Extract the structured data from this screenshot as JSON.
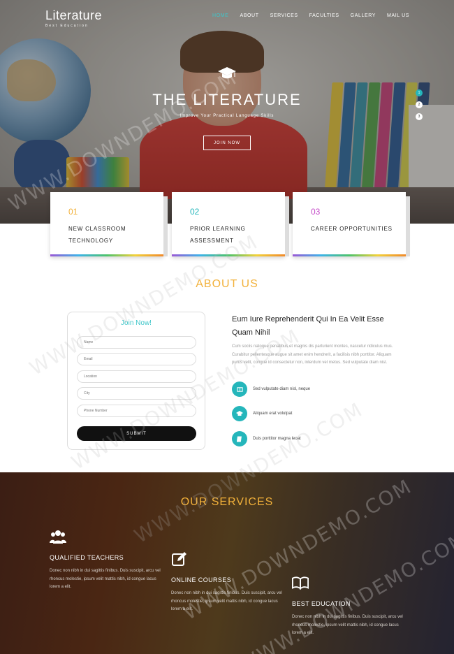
{
  "brand": {
    "title": "Literature",
    "subtitle": "Best Education"
  },
  "nav": {
    "items": [
      "HOME",
      "ABOUT",
      "SERVICES",
      "FACULTIES",
      "GALLERY",
      "MAIL US"
    ],
    "active": "HOME"
  },
  "hero": {
    "title": "THE LITERATURE",
    "subtitle": "Improve Your Practical Language Skills",
    "button": "JOIN NOW",
    "slides": [
      "1",
      "2",
      "3"
    ],
    "active_slide": "1"
  },
  "features": [
    {
      "num": "01",
      "title": "NEW CLASSROOM TECHNOLOGY",
      "color": "#f2b13a"
    },
    {
      "num": "02",
      "title": "PRIOR LEARNING ASSESSMENT",
      "color": "#25b6bb"
    },
    {
      "num": "03",
      "title": "CAREER OPPORTUNITIES",
      "color": "#c44bc8"
    }
  ],
  "about": {
    "title": "ABOUT US",
    "form": {
      "title": "Join Now!",
      "fields": [
        "Name",
        "Email",
        "Location",
        "City",
        "Phone Number"
      ],
      "submit": "SUBMIT"
    },
    "heading": "Eum Iure Reprehenderit Qui In Ea Velit Esse Quam Nihil",
    "body": "Cum sociis natoque penatibus et magnis dis parturient montes, nascetur ridiculus mus. Curabitur pellentesque augue sit amet enim hendrerit, a facilisis nibh porttitor. Aliquam purus velit, congue id consectetur non, interdum vel metus. Sed vulputate diam nisl.",
    "items": [
      {
        "icon": "book-icon",
        "label": "Sed vulputate diam nisl, neque"
      },
      {
        "icon": "graduation-cap-icon",
        "label": "Aliquam erat volutpat"
      },
      {
        "icon": "notebook-icon",
        "label": "Duis porttitor magna leoat"
      }
    ]
  },
  "services": {
    "title": "OUR SERVICES",
    "items": [
      {
        "icon": "users-icon",
        "title": "QUALIFIED TEACHERS",
        "desc": "Donec non nibh in dui sagittis finibus. Duis suscipit, arcu vel rhoncus molestie, ipsum velit mattis nibh, id congue lacus lorem a elit."
      },
      {
        "icon": "edit-icon",
        "title": "ONLINE COURSES",
        "desc": "Donec non nibh in dui sagittis finibus. Duis suscipit, arcu vel rhoncus molestie, ipsum velit mattis nibh, id congue lacus lorem a elit."
      },
      {
        "icon": "open-book-icon",
        "title": "BEST EDUCATION",
        "desc": "Donec non nibh in dui sagittis finibus. Duis suscipit, arcu vel rhoncus molestie, ipsum velit mattis nibh, id congue lacus lorem a elit."
      }
    ]
  },
  "watermark": "WWW.DOWNDEMO.COM",
  "colors": {
    "accent": "#25b6bb",
    "gold": "#f2b13a",
    "purple": "#c44bc8"
  }
}
